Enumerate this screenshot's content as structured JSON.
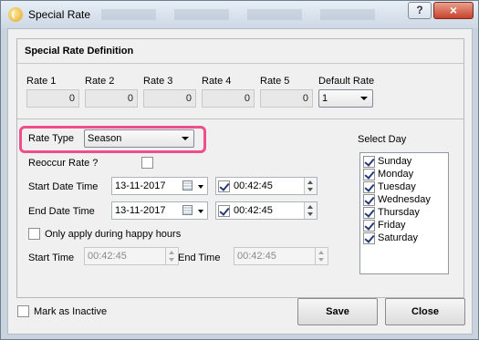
{
  "window": {
    "title": "Special Rate",
    "help_label": "?",
    "close_label": "×"
  },
  "panel": {
    "title": "Special Rate Definition",
    "rates": [
      {
        "label": "Rate 1",
        "value": "0"
      },
      {
        "label": "Rate 2",
        "value": "0"
      },
      {
        "label": "Rate 3",
        "value": "0"
      },
      {
        "label": "Rate 4",
        "value": "0"
      },
      {
        "label": "Rate 5",
        "value": "0"
      }
    ],
    "default_rate": {
      "label": "Default Rate",
      "value": "1"
    },
    "rate_type": {
      "label": "Rate Type",
      "value": "Season"
    },
    "reoccur": {
      "label": "Reoccur Rate ?",
      "checked": false
    },
    "start": {
      "label": "Start Date Time",
      "date": "13-11-2017",
      "time": "00:42:45",
      "time_checked": true
    },
    "end": {
      "label": "End Date Time",
      "date": "13-11-2017",
      "time": "00:42:45",
      "time_checked": true
    },
    "happy_hours": {
      "label": "Only apply during happy hours",
      "checked": false
    },
    "start_time": {
      "label": "Start Time",
      "value": "00:42:45"
    },
    "end_time": {
      "label": "End Time",
      "value": "00:42:45"
    },
    "select_day": {
      "label": "Select Day",
      "days": [
        {
          "name": "Sunday",
          "checked": true
        },
        {
          "name": "Monday",
          "checked": true
        },
        {
          "name": "Tuesday",
          "checked": true
        },
        {
          "name": "Wednesday",
          "checked": true
        },
        {
          "name": "Thursday",
          "checked": true
        },
        {
          "name": "Friday",
          "checked": true
        },
        {
          "name": "Saturday",
          "checked": true
        }
      ]
    }
  },
  "footer": {
    "inactive": {
      "label": "Mark as Inactive",
      "checked": false
    },
    "save_label": "Save",
    "close_label": "Close"
  },
  "colors": {
    "highlight": "#ee4e8b",
    "close_button": "#c8412b"
  }
}
